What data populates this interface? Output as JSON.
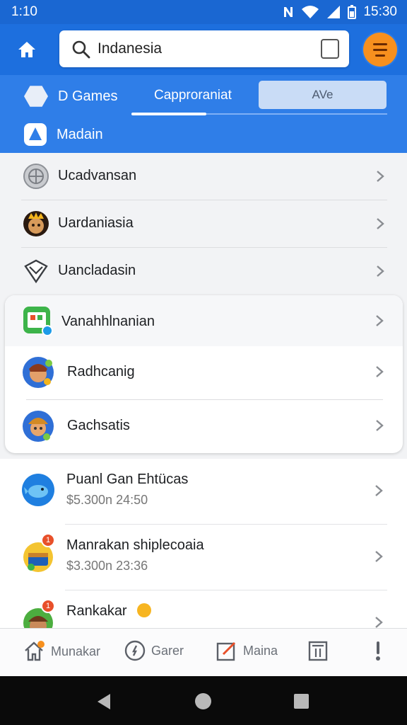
{
  "status_bar": {
    "time": "1:10",
    "clock": "15:30"
  },
  "search": {
    "value": "Indanesia"
  },
  "tabs": {
    "games_label": "D Games",
    "competitor_label": "Capproraniat",
    "ave_label": "AVe",
    "medium_label": "Madain"
  },
  "list": [
    {
      "label": "Ucadvansan",
      "icon": "globe-icon"
    },
    {
      "label": "Uardaniasia",
      "icon": "character-avatar-icon"
    },
    {
      "label": "Uancladasin",
      "icon": "shield-icon"
    }
  ],
  "card": {
    "header": {
      "label": "Vanahhlnanian",
      "icon": "green-game-icon"
    },
    "rows": [
      {
        "label": "Radhcanig",
        "icon": "character-avatar-icon"
      },
      {
        "label": "Gachsatis",
        "icon": "character-avatar-icon"
      }
    ]
  },
  "deals": [
    {
      "title": "Puanl Gan Ehtücas",
      "price": "$5.300n 24:50",
      "icon": "whale-icon",
      "badge": ""
    },
    {
      "title": "Manrakan shiplecoaia",
      "price": "$3.300n 23:36",
      "icon": "treasure-icon",
      "badge": "1"
    },
    {
      "title": "Rankakar",
      "price": "",
      "icon": "character-avatar-icon",
      "badge": "1"
    }
  ],
  "bottom_nav": {
    "home_label": "Munakar",
    "games_label": "Garer",
    "edit_label": "Maina"
  },
  "colors": {
    "primary": "#1d6fde",
    "tab_bg": "#2f7ee8",
    "accent_orange": "#f7901e"
  }
}
